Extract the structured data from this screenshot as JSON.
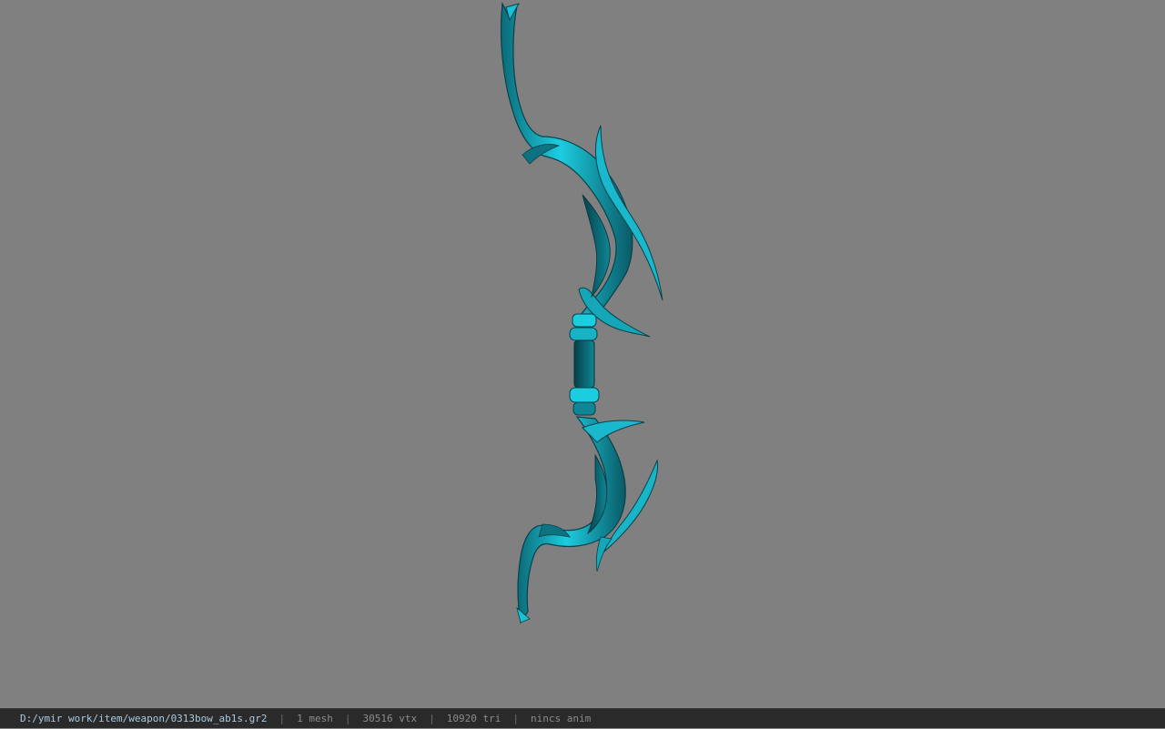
{
  "viewport": {
    "background": "#808080",
    "model_color": "#1cc0d4",
    "model_dark": "#0b5560",
    "model_name": "bow-model"
  },
  "status": {
    "path": "D:/ymir work/item/weapon/0313bow_ab1s.gr2",
    "separator": "|",
    "mesh": "1 mesh",
    "vertices": "30516 vtx",
    "triangles": "10920 tri",
    "anim": "nincs anim"
  }
}
